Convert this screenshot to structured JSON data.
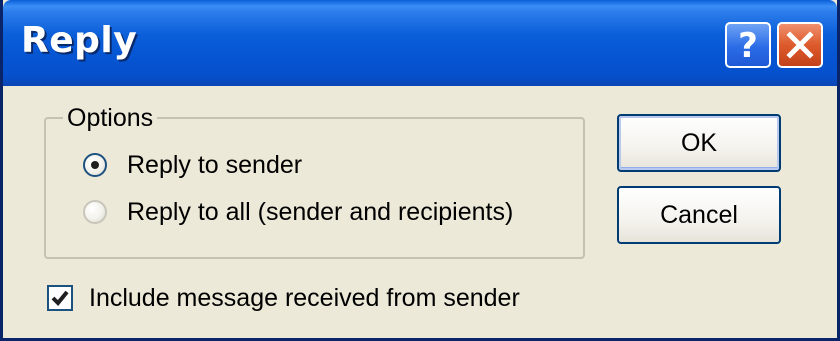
{
  "window": {
    "title": "Reply",
    "help_glyph": "?"
  },
  "options": {
    "legend": "Options",
    "items": [
      {
        "label": "Reply to sender",
        "selected": true
      },
      {
        "label": "Reply to all (sender and recipients)",
        "selected": false
      }
    ]
  },
  "include": {
    "label": "Include message received from sender",
    "checked": true
  },
  "buttons": {
    "ok_label": "OK",
    "cancel_label": "Cancel"
  },
  "icons": {
    "help": "question-mark-icon",
    "close": "close-x-icon",
    "check": "checkmark-icon"
  },
  "colors": {
    "titlebar": "#0655D3",
    "dialog_bg": "#ECE9D8",
    "close_button": "#DD5A2B",
    "help_button": "#2B6CE6",
    "button_border": "#003C74"
  }
}
